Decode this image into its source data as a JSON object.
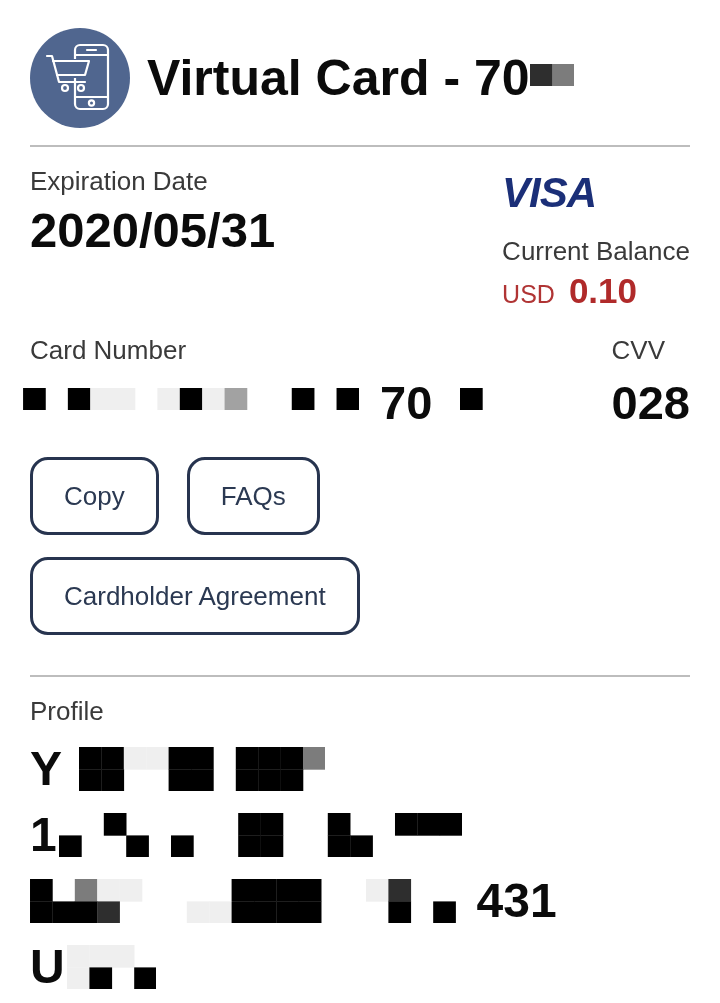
{
  "header": {
    "title": [
      {
        "kind": "text",
        "text": "Virtual Card - 70"
      },
      {
        "kind": "redacted"
      }
    ]
  },
  "card": {
    "expiration_label": "Expiration Date",
    "expiration_date": "2020/05/31",
    "brand": "VISA",
    "balance_label": "Current Balance",
    "currency": "USD",
    "balance": "0.10"
  },
  "card_number": {
    "label": "Card Number",
    "value": [
      {
        "kind": "redacted"
      },
      {
        "kind": "text",
        "text": "70"
      },
      {
        "kind": "redacted"
      }
    ]
  },
  "cvv": {
    "label": "CVV",
    "value": "028"
  },
  "buttons": [
    {
      "label": "Copy"
    },
    {
      "label": "FAQs"
    },
    {
      "label": "Cardholder Agreement"
    }
  ],
  "profile": {
    "label": "Profile",
    "lines": [
      [
        {
          "kind": "text",
          "text": "Y"
        },
        {
          "kind": "redacted"
        }
      ],
      [
        {
          "kind": "text",
          "text": "1"
        },
        {
          "kind": "redacted"
        }
      ],
      [
        {
          "kind": "redacted"
        },
        {
          "kind": "text",
          "text": "431"
        }
      ],
      [
        {
          "kind": "text",
          "text": "U"
        },
        {
          "kind": "redacted"
        }
      ]
    ]
  }
}
